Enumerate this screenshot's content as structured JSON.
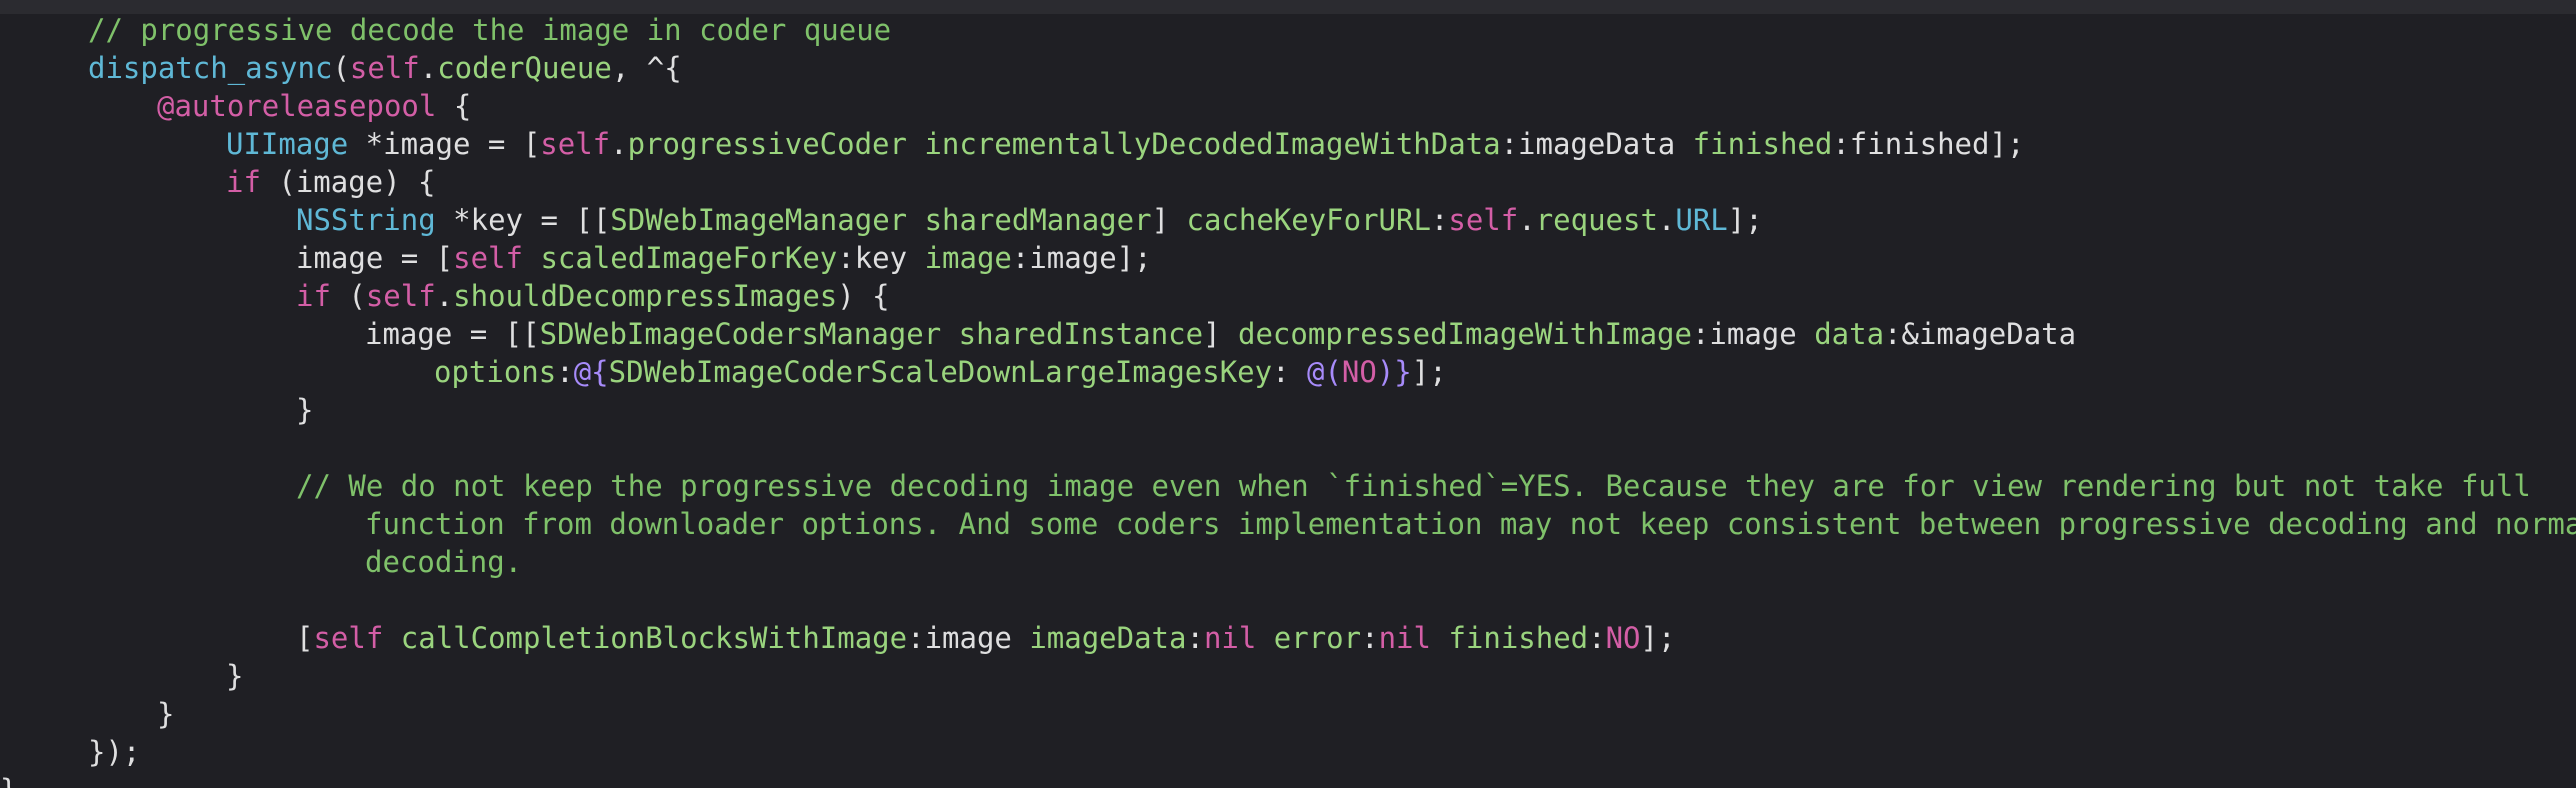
{
  "editor": {
    "colors": {
      "background": "#1f1f24",
      "comment": "#7fc16a",
      "keyword": "#d35ea6",
      "type": "#5fb8d6",
      "method": "#9ad47e",
      "plain": "#dfdfe0"
    },
    "lines": [
      [
        {
          "t": "// progressive decode the image in coder queue",
          "c": "comment"
        }
      ],
      [
        {
          "t": "dispatch_async",
          "c": "func"
        },
        {
          "t": "(",
          "c": "plain"
        },
        {
          "t": "self",
          "c": "self"
        },
        {
          "t": ".",
          "c": "plain"
        },
        {
          "t": "coderQueue",
          "c": "prop"
        },
        {
          "t": ", ^{",
          "c": "plain"
        }
      ],
      [
        {
          "t": "@autoreleasepool",
          "c": "keyword"
        },
        {
          "t": " {",
          "c": "plain"
        }
      ],
      [
        {
          "t": "UIImage",
          "c": "type"
        },
        {
          "t": " *image = [",
          "c": "plain"
        },
        {
          "t": "self",
          "c": "self"
        },
        {
          "t": ".",
          "c": "plain"
        },
        {
          "t": "progressiveCoder",
          "c": "prop"
        },
        {
          "t": " ",
          "c": "plain"
        },
        {
          "t": "incrementallyDecodedImageWithData",
          "c": "method"
        },
        {
          "t": ":imageData ",
          "c": "plain"
        },
        {
          "t": "finished",
          "c": "method"
        },
        {
          "t": ":finished];",
          "c": "plain"
        }
      ],
      [
        {
          "t": "if",
          "c": "keyword"
        },
        {
          "t": " (image) {",
          "c": "plain"
        }
      ],
      [
        {
          "t": "NSString",
          "c": "type"
        },
        {
          "t": " *key = [[",
          "c": "plain"
        },
        {
          "t": "SDWebImageManager",
          "c": "class"
        },
        {
          "t": " ",
          "c": "plain"
        },
        {
          "t": "sharedManager",
          "c": "method"
        },
        {
          "t": "] ",
          "c": "plain"
        },
        {
          "t": "cacheKeyForURL",
          "c": "method"
        },
        {
          "t": ":",
          "c": "plain"
        },
        {
          "t": "self",
          "c": "self"
        },
        {
          "t": ".",
          "c": "plain"
        },
        {
          "t": "request",
          "c": "prop"
        },
        {
          "t": ".",
          "c": "plain"
        },
        {
          "t": "URL",
          "c": "type"
        },
        {
          "t": "];",
          "c": "plain"
        }
      ],
      [
        {
          "t": "image = [",
          "c": "plain"
        },
        {
          "t": "self",
          "c": "self"
        },
        {
          "t": " ",
          "c": "plain"
        },
        {
          "t": "scaledImageForKey",
          "c": "method"
        },
        {
          "t": ":key ",
          "c": "plain"
        },
        {
          "t": "image",
          "c": "method"
        },
        {
          "t": ":image];",
          "c": "plain"
        }
      ],
      [
        {
          "t": "if",
          "c": "keyword"
        },
        {
          "t": " (",
          "c": "plain"
        },
        {
          "t": "self",
          "c": "self"
        },
        {
          "t": ".",
          "c": "plain"
        },
        {
          "t": "shouldDecompressImages",
          "c": "prop"
        },
        {
          "t": ") {",
          "c": "plain"
        }
      ],
      [
        {
          "t": "image = [[",
          "c": "plain"
        },
        {
          "t": "SDWebImageCodersManager",
          "c": "class"
        },
        {
          "t": " ",
          "c": "plain"
        },
        {
          "t": "sharedInstance",
          "c": "method"
        },
        {
          "t": "] ",
          "c": "plain"
        },
        {
          "t": "decompressedImageWithImage",
          "c": "method"
        },
        {
          "t": ":image ",
          "c": "plain"
        },
        {
          "t": "data",
          "c": "method"
        },
        {
          "t": ":&imageData",
          "c": "plain"
        }
      ],
      [
        {
          "t": "options",
          "c": "method"
        },
        {
          "t": ":",
          "c": "plain"
        },
        {
          "t": "@{",
          "c": "atbrace"
        },
        {
          "t": "SDWebImageCoderScaleDownLargeImagesKey",
          "c": "class"
        },
        {
          "t": ": ",
          "c": "plain"
        },
        {
          "t": "@(",
          "c": "atbrace"
        },
        {
          "t": "NO",
          "c": "lit"
        },
        {
          "t": ")}",
          "c": "atbrace"
        },
        {
          "t": "];",
          "c": "plain"
        }
      ],
      [
        {
          "t": "}",
          "c": "plain"
        }
      ],
      [],
      [
        {
          "t": "// We do not keep the progressive decoding image even when `finished`=YES. Because they are for view rendering but not take full",
          "c": "comment"
        }
      ],
      [
        {
          "t": "function from downloader options. And some coders implementation may not keep consistent between progressive decoding and normal",
          "c": "comment"
        }
      ],
      [
        {
          "t": "decoding.",
          "c": "comment"
        }
      ],
      [],
      [
        {
          "t": "[",
          "c": "plain"
        },
        {
          "t": "self",
          "c": "self"
        },
        {
          "t": " ",
          "c": "plain"
        },
        {
          "t": "callCompletionBlocksWithImage",
          "c": "method"
        },
        {
          "t": ":image ",
          "c": "plain"
        },
        {
          "t": "imageData",
          "c": "method"
        },
        {
          "t": ":",
          "c": "plain"
        },
        {
          "t": "nil",
          "c": "lit"
        },
        {
          "t": " ",
          "c": "plain"
        },
        {
          "t": "error",
          "c": "method"
        },
        {
          "t": ":",
          "c": "plain"
        },
        {
          "t": "nil",
          "c": "lit"
        },
        {
          "t": " ",
          "c": "plain"
        },
        {
          "t": "finished",
          "c": "method"
        },
        {
          "t": ":",
          "c": "plain"
        },
        {
          "t": "NO",
          "c": "lit"
        },
        {
          "t": "];",
          "c": "plain"
        }
      ],
      [
        {
          "t": "}",
          "c": "plain"
        }
      ],
      [
        {
          "t": "}",
          "c": "plain"
        }
      ],
      [
        {
          "t": "});",
          "c": "plain"
        }
      ],
      [
        {
          "t": "}",
          "c": "plain"
        }
      ]
    ]
  }
}
